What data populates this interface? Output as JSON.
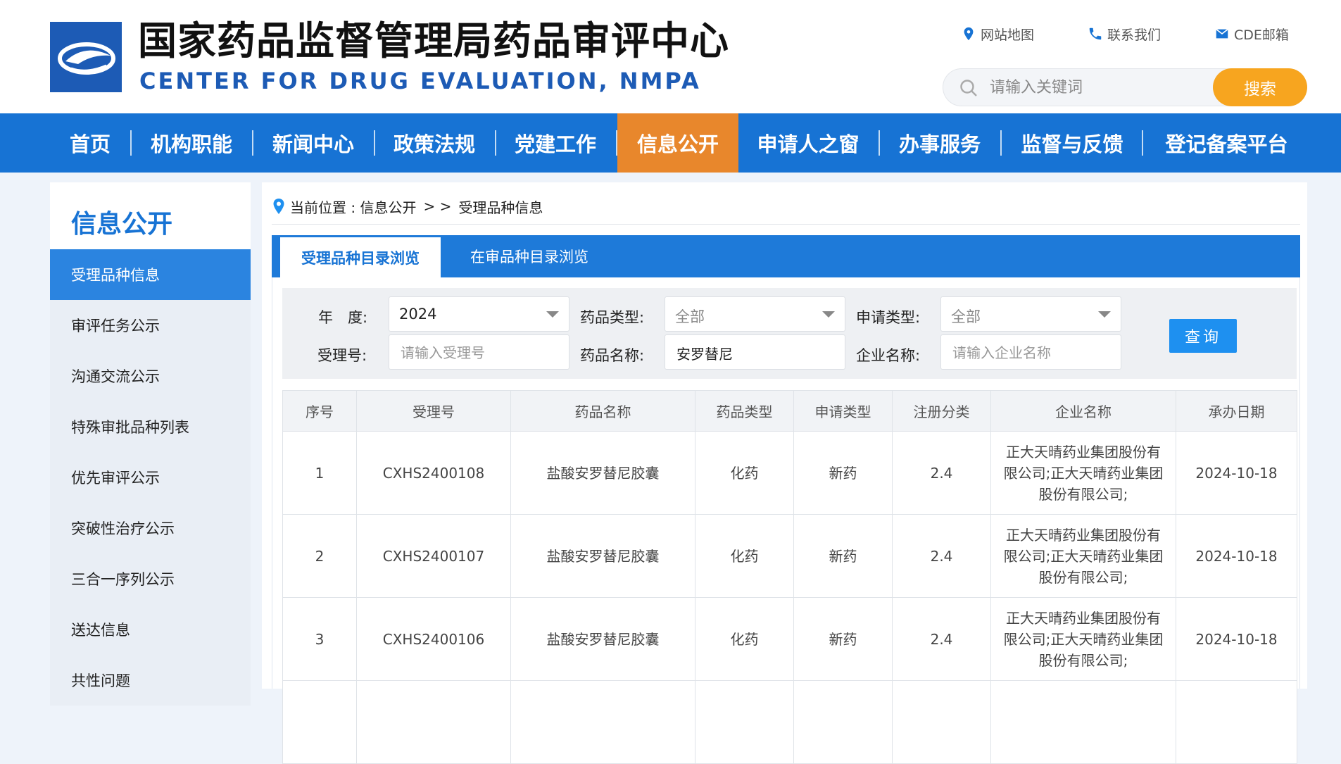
{
  "header": {
    "title_cn": "国家药品监督管理局药品审评中心",
    "title_en": "CENTER FOR DRUG EVALUATION, NMPA",
    "links": [
      {
        "icon": "location-pin-icon",
        "label": "网站地图"
      },
      {
        "icon": "phone-icon",
        "label": "联系我们"
      },
      {
        "icon": "mail-icon",
        "label": "CDE邮箱"
      }
    ],
    "search": {
      "placeholder": "请输入关键词",
      "button": "搜索"
    }
  },
  "nav": {
    "items": [
      "首页",
      "机构职能",
      "新闻中心",
      "政策法规",
      "党建工作",
      "信息公开",
      "申请人之窗",
      "办事服务",
      "监督与反馈",
      "登记备案平台"
    ],
    "active": "信息公开"
  },
  "sidebar": {
    "title": "信息公开",
    "items": [
      "受理品种信息",
      "审评任务公示",
      "沟通交流公示",
      "特殊审批品种列表",
      "优先审评公示",
      "突破性治疗公示",
      "三合一序列公示",
      "送达信息",
      "共性问题"
    ],
    "active": "受理品种信息"
  },
  "breadcrumb": {
    "prefix": "当前位置 : 信息公开",
    "sep": "> >",
    "current": "受理品种信息"
  },
  "tabs": [
    "受理品种目录浏览",
    "在审品种目录浏览"
  ],
  "filter": {
    "year_label": "年　度:",
    "year_value": "2024",
    "drug_type_label": "药品类型:",
    "drug_type_value": "全部",
    "apply_type_label": "申请类型:",
    "apply_type_value": "全部",
    "accept_no_label": "受理号:",
    "accept_no_placeholder": "请输入受理号",
    "drug_name_label": "药品名称:",
    "drug_name_value": "安罗替尼",
    "company_label": "企业名称:",
    "company_placeholder": "请输入企业名称",
    "query_button": "查询"
  },
  "table": {
    "headers": [
      "序号",
      "受理号",
      "药品名称",
      "药品类型",
      "申请类型",
      "注册分类",
      "企业名称",
      "承办日期"
    ],
    "rows": [
      [
        "1",
        "CXHS2400108",
        "盐酸安罗替尼胶囊",
        "化药",
        "新药",
        "2.4",
        "正大天晴药业集团股份有限公司;正大天晴药业集团股份有限公司;",
        "2024-10-18"
      ],
      [
        "2",
        "CXHS2400107",
        "盐酸安罗替尼胶囊",
        "化药",
        "新药",
        "2.4",
        "正大天晴药业集团股份有限公司;正大天晴药业集团股份有限公司;",
        "2024-10-18"
      ],
      [
        "3",
        "CXHS2400106",
        "盐酸安罗替尼胶囊",
        "化药",
        "新药",
        "2.4",
        "正大天晴药业集团股份有限公司;正大天晴药业集团股份有限公司;",
        "2024-10-18"
      ],
      [
        "",
        "",
        "",
        "",
        "",
        "",
        "",
        ""
      ]
    ]
  },
  "colors": {
    "nav_blue": "#1773d4",
    "active_orange": "#e8872c",
    "search_orange": "#f7a51f",
    "query_blue": "#1e90f0"
  }
}
